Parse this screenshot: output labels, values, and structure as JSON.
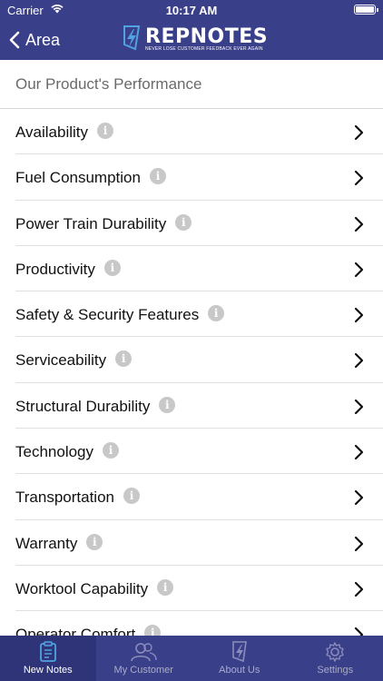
{
  "status_bar": {
    "carrier": "Carrier",
    "time": "10:17 AM"
  },
  "nav": {
    "back_label": "Area",
    "logo_text": "REPNOTES",
    "logo_tagline": "NEVER LOSE CUSTOMER FEEDBACK EVER AGAIN"
  },
  "section": {
    "title": "Our Product's Performance"
  },
  "items": [
    {
      "label": "Availability"
    },
    {
      "label": "Fuel Consumption"
    },
    {
      "label": "Power Train Durability"
    },
    {
      "label": "Productivity"
    },
    {
      "label": "Safety & Security Features"
    },
    {
      "label": "Serviceability"
    },
    {
      "label": "Structural Durability"
    },
    {
      "label": "Technology"
    },
    {
      "label": "Transportation"
    },
    {
      "label": "Warranty"
    },
    {
      "label": "Worktool Capability"
    },
    {
      "label": "Operator Comfort"
    }
  ],
  "info_icon_text": "i",
  "tabs": [
    {
      "label": "New Notes",
      "icon": "notes-icon",
      "active": true
    },
    {
      "label": "My Customer",
      "icon": "customers-icon",
      "active": false
    },
    {
      "label": "About Us",
      "icon": "bolt-icon",
      "active": false
    },
    {
      "label": "Settings",
      "icon": "gear-icon",
      "active": false
    }
  ],
  "colors": {
    "header": "#3a3f8a",
    "tab_active": "#ffffff",
    "tab_inactive": "#a9acc9",
    "info": "#c8c8c8"
  }
}
